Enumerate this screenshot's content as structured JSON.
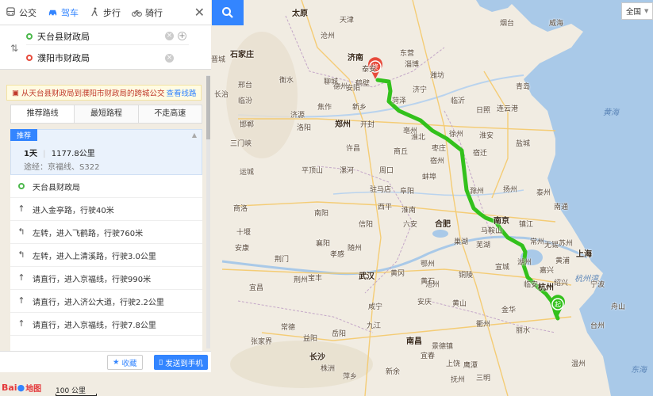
{
  "modes": [
    {
      "label": "公交",
      "icon": "bus-icon",
      "active": false
    },
    {
      "label": "驾车",
      "icon": "car-icon",
      "active": true
    },
    {
      "label": "步行",
      "icon": "walk-icon",
      "active": false
    },
    {
      "label": "骑行",
      "icon": "bike-icon",
      "active": false
    }
  ],
  "route": {
    "from": "天台县财政局",
    "to": "濮阳市财政局"
  },
  "notice": {
    "text": "从天台县财政局到濮阳市财政局的跨城公交",
    "link": "查看线路"
  },
  "tabs": [
    "推荐路线",
    "最短路程",
    "不走高速"
  ],
  "recommend": {
    "badge": "推荐",
    "days": "1天",
    "distance": "1177.8公里",
    "via": "途经：京福线、S322"
  },
  "steps": [
    {
      "text": "天台县财政局",
      "icon": "start-dot-icon"
    },
    {
      "text": "进入金亭路，行驶40米",
      "icon": "straight-arrow-icon"
    },
    {
      "text": "左转，进入飞鹤路，行驶760米",
      "icon": "turn-left-icon"
    },
    {
      "text": "左转，进入上清溪路，行驶3.0公里",
      "icon": "turn-left-icon"
    },
    {
      "text": "请直行，进入京福线，行驶990米",
      "icon": "straight-arrow-icon"
    },
    {
      "text": "请直行，进入济公大道，行驶2.2公里",
      "icon": "straight-arrow-icon"
    },
    {
      "text": "请直行，进入京福线，行驶7.8公里",
      "icon": "straight-arrow-icon"
    }
  ],
  "footer": {
    "favorite": "收藏",
    "send": "发送到手机"
  },
  "map": {
    "city_select": "全国",
    "scale": "100 公里",
    "logo": "地图",
    "start_label": "起",
    "end_label": "终",
    "route_color": "#33c11c",
    "accent_color": "#3385ff",
    "seas": [
      "黄海",
      "杭州湾",
      "东海"
    ],
    "cities": [
      "太原",
      "石家庄",
      "沧州",
      "天津",
      "邢台",
      "衡水",
      "德州",
      "东营",
      "烟台",
      "威海",
      "青岛",
      "日照",
      "济南",
      "泰安",
      "淄博",
      "潍坊",
      "临沂",
      "聊城",
      "邯郸",
      "晋城",
      "长治",
      "安阳",
      "鹤壁",
      "新乡",
      "焦作",
      "济源",
      "郑州",
      "开封",
      "洛阳",
      "许昌",
      "平顶山",
      "商丘",
      "周口",
      "漯河",
      "三门峡",
      "南阳",
      "驻马店",
      "信阳",
      "菏泽",
      "济宁",
      "枣庄",
      "徐州",
      "宿迁",
      "连云港",
      "盐城",
      "淮安",
      "扬州",
      "泰州",
      "南通",
      "镇江",
      "南京",
      "常州",
      "无锡",
      "苏州",
      "上海",
      "宿州",
      "淮北",
      "蚌埠",
      "阜阳",
      "滁州",
      "六安",
      "合肥",
      "巢湖",
      "马鞍山",
      "芜湖",
      "铜陵",
      "宣城",
      "池州",
      "安庆",
      "黄山",
      "湖州",
      "嘉兴",
      "杭州",
      "绍兴",
      "宁波",
      "舟山",
      "台州",
      "金华",
      "衢州",
      "丽水",
      "温州",
      "武汉",
      "孝感",
      "黄冈",
      "鄂州",
      "黄石",
      "咸宁",
      "十堰",
      "襄阳",
      "随州",
      "荆门",
      "荆州",
      "宜昌",
      "岳阳",
      "长沙",
      "株洲",
      "南昌",
      "九江",
      "景德镇",
      "上饶",
      "鹰潭",
      "宜春",
      "抚州",
      "张家界",
      "常德",
      "益阳",
      "新余",
      "萍乡",
      "运城",
      "商洛",
      "安康",
      "宝丰",
      "临汾",
      "亳州",
      "淮南",
      "黄浦",
      "临安",
      "三明",
      "西平"
    ]
  }
}
